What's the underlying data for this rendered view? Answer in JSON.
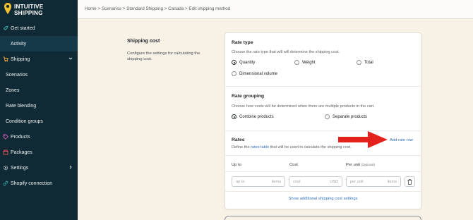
{
  "brand": {
    "line1": "INTUITIVE",
    "line2": "SHIPPING"
  },
  "sidebar": {
    "items": [
      {
        "label": "Get started",
        "icon": "rocket-icon"
      },
      {
        "label": "Activity",
        "icon": "none"
      },
      {
        "label": "Shipping",
        "icon": "cart-icon",
        "expanded": true
      },
      {
        "label": "Scenarios"
      },
      {
        "label": "Zones"
      },
      {
        "label": "Rate blending"
      },
      {
        "label": "Condition groups"
      },
      {
        "label": "Products",
        "icon": "tag-icon"
      },
      {
        "label": "Packages",
        "icon": "box-icon"
      },
      {
        "label": "Settings",
        "icon": "gear-icon"
      },
      {
        "label": "Shopify connection",
        "icon": "link-icon"
      }
    ]
  },
  "breadcrumb": "Home > Scenarios > Standard Shipping > Canada > Edit shipping method",
  "section": {
    "title": "Shipping cost",
    "description": "Configure the settings for calculating the shipping cost."
  },
  "rate_type": {
    "title": "Rate type",
    "description": "Choose the rate type that will will determine the shipping cost.",
    "options": [
      "Quantity",
      "Weight",
      "Total",
      "Dimensional volume"
    ],
    "selected": "Quantity"
  },
  "rate_grouping": {
    "title": "Rate grouping",
    "description": "Choose how costs will be determined when there are multiple products in the cart.",
    "options": [
      "Combine products",
      "Separate products"
    ],
    "selected": "Combine products"
  },
  "rates": {
    "title": "Rates",
    "desc_prefix": "Define the",
    "desc_link": "rates table",
    "desc_suffix": "that will be used to calculate the shipping cost.",
    "add_row": "Add rate row",
    "columns": {
      "up_to": "Up to",
      "cost": "Cost",
      "per_unit": "Per unit",
      "per_unit_note": "(Optional)"
    },
    "row": {
      "up_to_placeholder": "up to",
      "up_to_unit": "items",
      "cost_placeholder": "cost",
      "cost_unit": "USD",
      "per_unit_placeholder": "per unit",
      "per_unit_unit": "items"
    },
    "show_more": "Show additional shipping cost settings"
  },
  "colors": {
    "sidebar": "#0f2a35",
    "accent": "#f2c230",
    "link": "#2f6eba",
    "arrow": "#e3231b"
  }
}
